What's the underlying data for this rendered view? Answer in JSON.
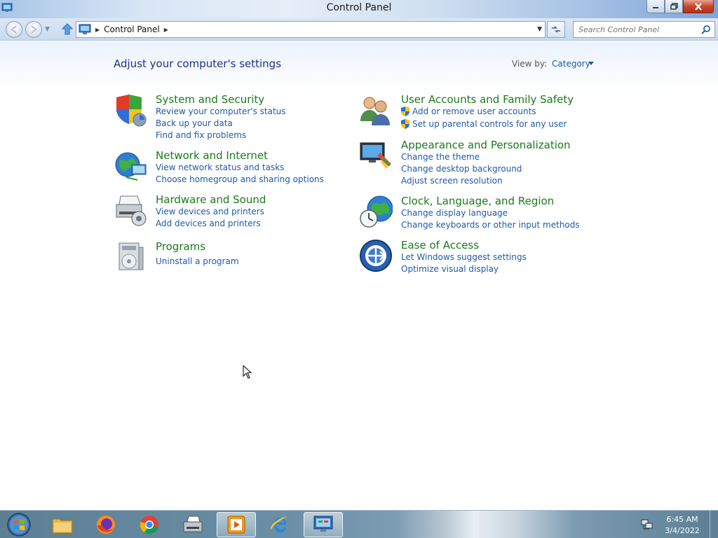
{
  "window": {
    "title": "Control Panel"
  },
  "navbar": {
    "breadcrumb": "Control Panel",
    "search_placeholder": "Search Control Panel"
  },
  "content": {
    "heading": "Adjust your computer's settings",
    "view_by_label": "View by:",
    "view_by_value": "Category",
    "categories": [
      {
        "title": "System and Security",
        "icon": "shield-icon",
        "links": [
          "Review your computer's status",
          "Back up your data",
          "Find and fix problems"
        ]
      },
      {
        "title": "Network and Internet",
        "icon": "globe-network-icon",
        "links": [
          "View network status and tasks",
          "Choose homegroup and sharing options"
        ]
      },
      {
        "title": "Hardware and Sound",
        "icon": "printer-icon",
        "links": [
          "View devices and printers",
          "Add devices and printers"
        ]
      },
      {
        "title": "Programs",
        "icon": "programs-icon",
        "links": [
          "Uninstall a program"
        ]
      },
      {
        "title": "User Accounts and Family Safety",
        "icon": "users-icon",
        "links": [
          "Add or remove user accounts",
          "Set up parental controls for any user"
        ]
      },
      {
        "title": "Appearance and Personalization",
        "icon": "monitor-paint-icon",
        "links": [
          "Change the theme",
          "Change desktop background",
          "Adjust screen resolution"
        ]
      },
      {
        "title": "Clock, Language, and Region",
        "icon": "globe-clock-icon",
        "links": [
          "Change display language",
          "Change keyboards or other input methods"
        ]
      },
      {
        "title": "Ease of Access",
        "icon": "ease-of-access-icon",
        "links": [
          "Let Windows suggest settings",
          "Optimize visual display"
        ]
      }
    ]
  },
  "taskbar": {
    "items": [
      "file-explorer-icon",
      "firefox-icon",
      "chrome-icon",
      "printer-fax-icon",
      "media-player-icon",
      "internet-explorer-icon",
      "control-panel-icon"
    ],
    "time": "6:45 AM",
    "date": "3/4/2022"
  },
  "colors": {
    "link": "#1e5aa8",
    "category_title": "#1a7a1a",
    "heading": "#1e3287"
  }
}
